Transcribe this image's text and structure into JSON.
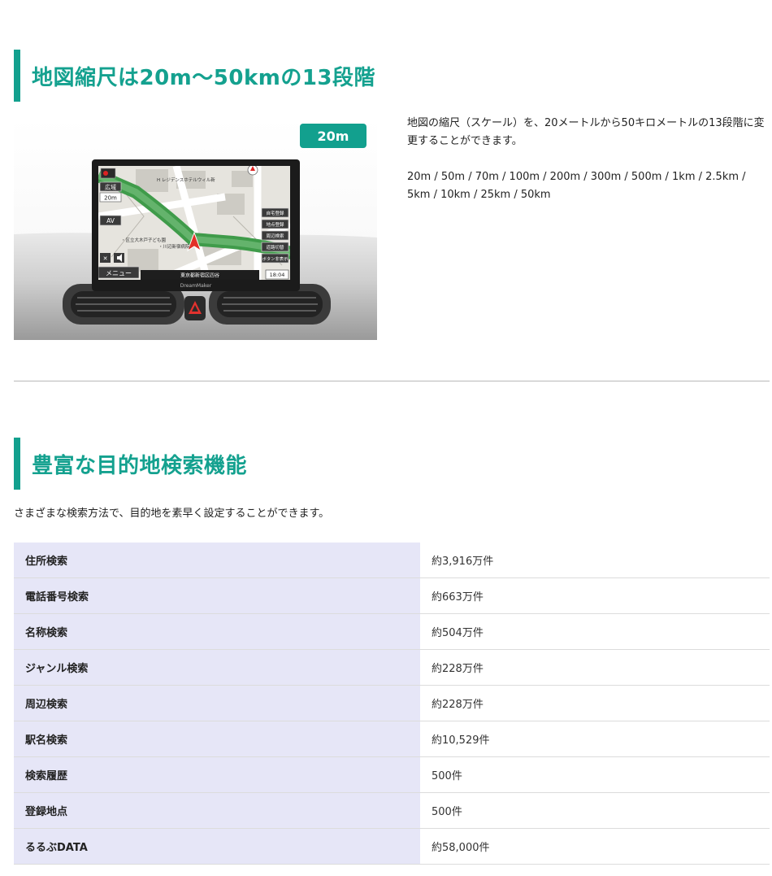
{
  "section1": {
    "title": "地図縮尺は20m〜50kmの13段階",
    "badge": "20m",
    "description": "地図の縮尺（スケール）を、20メートルから50キロメートルの13段階に変更することができます。",
    "scales": "20m / 50m / 70m / 100m / 200m / 300m / 500m / 1km / 2.5km / 5km / 10km / 25km / 50km",
    "screen": {
      "btn_wide": "広域",
      "scale_label": "20m",
      "btn_av": "AV",
      "btn_menu": "メニュー",
      "right_buttons": [
        "自宅登録",
        "地点登録",
        "周辺検索",
        "道路切替",
        "ボタン非表示"
      ],
      "time": "18:04",
      "location": "東京都新宿区四谷",
      "brand": "DreamMaker",
      "poi1": "H レジデンスホテルウィル新",
      "poi2": "・区立大木戸子ども園",
      "poi3": "・川辺新宿病院"
    }
  },
  "section2": {
    "title": "豊富な目的地検索機能",
    "intro": "さまざまな検索方法で、目的地を素早く設定することができます。",
    "rows": [
      {
        "label": "住所検索",
        "value": "約3,916万件"
      },
      {
        "label": "電話番号検索",
        "value": "約663万件"
      },
      {
        "label": "名称検索",
        "value": "約504万件"
      },
      {
        "label": "ジャンル検索",
        "value": "約228万件"
      },
      {
        "label": "周辺検索",
        "value": "約228万件"
      },
      {
        "label": "駅名検索",
        "value": "約10,529件"
      },
      {
        "label": "検索履歴",
        "value": "500件"
      },
      {
        "label": "登録地点",
        "value": "500件"
      },
      {
        "label": "るるぶDATA",
        "value": "約58,000件"
      }
    ]
  },
  "colors": {
    "accent": "#12a08e",
    "table_key_bg": "#e6e6f7",
    "route": "#3f9b4a"
  }
}
